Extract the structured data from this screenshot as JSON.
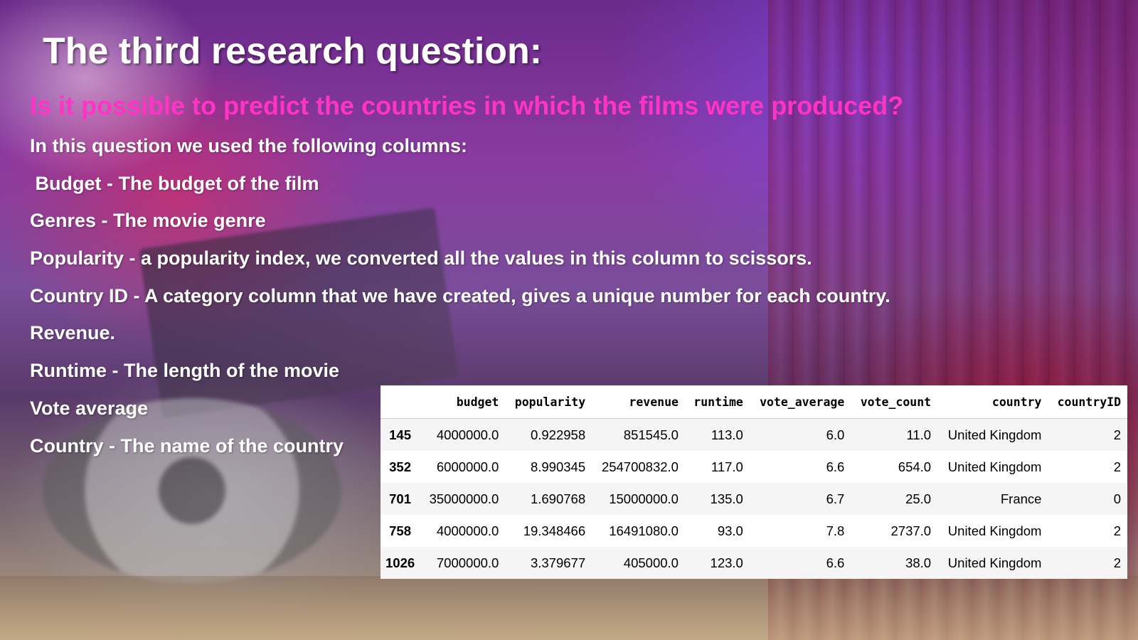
{
  "slide": {
    "title": "The third research question:",
    "subtitle": "Is it possible to predict the countries in which the films were produced?",
    "lines": [
      "In this question we used the following columns:",
      " Budget - The budget of the film",
      "Genres - The movie genre",
      "Popularity - a popularity index, we converted all the values in this column to scissors.",
      "Country ID - A category column that we have created, gives a unique number for each country.",
      "Revenue.",
      "Runtime - The length of the movie",
      "Vote average",
      "Country - The name of the country"
    ]
  },
  "table": {
    "columns": [
      "",
      "budget",
      "popularity",
      "revenue",
      "runtime",
      "vote_average",
      "vote_count",
      "country",
      "countryID"
    ],
    "rows": [
      [
        "145",
        "4000000.0",
        "0.922958",
        "851545.0",
        "113.0",
        "6.0",
        "11.0",
        "United Kingdom",
        "2"
      ],
      [
        "352",
        "6000000.0",
        "8.990345",
        "254700832.0",
        "117.0",
        "6.6",
        "654.0",
        "United Kingdom",
        "2"
      ],
      [
        "701",
        "35000000.0",
        "1.690768",
        "15000000.0",
        "135.0",
        "6.7",
        "25.0",
        "France",
        "0"
      ],
      [
        "758",
        "4000000.0",
        "19.348466",
        "16491080.0",
        "93.0",
        "7.8",
        "2737.0",
        "United Kingdom",
        "2"
      ],
      [
        "1026",
        "7000000.0",
        "3.379677",
        "405000.0",
        "123.0",
        "6.6",
        "38.0",
        "United Kingdom",
        "2"
      ]
    ]
  }
}
